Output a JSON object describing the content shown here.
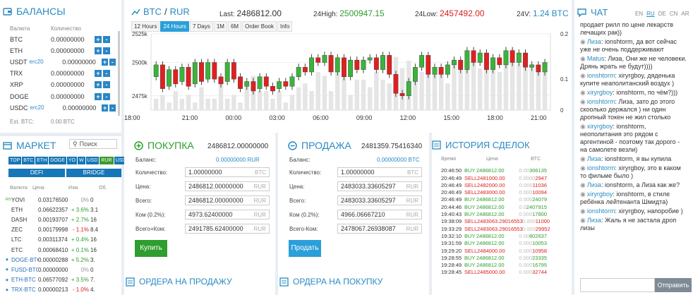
{
  "balances": {
    "title": "БАЛАНСЫ",
    "col_currency": "Валюта",
    "col_amount": "Количество",
    "rows": [
      {
        "c": "BTC",
        "tag": "",
        "v": "0.00000000"
      },
      {
        "c": "ETH",
        "tag": "",
        "v": "0.00000000"
      },
      {
        "c": "USDT",
        "tag": "erc20",
        "v": "0.00000000"
      },
      {
        "c": "TRX",
        "tag": "",
        "v": "0.00000000"
      },
      {
        "c": "XRP",
        "tag": "",
        "v": "0.00000000"
      },
      {
        "c": "DOGE",
        "tag": "",
        "v": "0.00000000"
      },
      {
        "c": "USDC",
        "tag": "erc20",
        "v": "0.00000000"
      }
    ],
    "est_label": "Est. BTC:",
    "est_value": "0.00 BTC",
    "plus": "+",
    "minus": "-"
  },
  "market": {
    "title": "МАРКЕТ",
    "search_placeholder": "Поиск",
    "tabs": [
      "TOP",
      "BTC",
      "ETH",
      "DOGE",
      "YO",
      "W",
      "USD",
      "RUR",
      "USDT"
    ],
    "subtabs": [
      "DEFI",
      "BRIDGE"
    ],
    "cols": [
      "Валюта",
      "Цена",
      "Изм.",
      "Об."
    ],
    "rows": [
      {
        "c": "YOVI",
        "p": "0.03176500",
        "ch": "0%",
        "o": "0",
        "cls": "gray",
        "icon": "ROM"
      },
      {
        "c": "ETH",
        "p": "0.06622357",
        "ch": "+ 3.6%",
        "o": "3.1",
        "cls": "green",
        "icon": ""
      },
      {
        "c": "DASH",
        "p": "0.00193707",
        "ch": "+ 2.7%",
        "o": "16",
        "cls": "green",
        "icon": ""
      },
      {
        "c": "ZEC",
        "p": "0.00179998",
        "ch": "- 1.1%",
        "o": "8.4",
        "cls": "red",
        "icon": ""
      },
      {
        "c": "LTC",
        "p": "0.00311374",
        "ch": "+ 0.4%",
        "o": "16",
        "cls": "green",
        "icon": ""
      },
      {
        "c": "ETC",
        "p": "0.00068410",
        "ch": "+ 0.1%",
        "o": "16",
        "cls": "green",
        "icon": ""
      },
      {
        "c": "DOGE-BTC",
        "p": "0.00000288",
        "ch": "+ 5.2%",
        "o": "3.",
        "cls": "green",
        "icon": "◆"
      },
      {
        "c": "FUSD-BTC",
        "p": "0.00000000",
        "ch": "0%",
        "o": "0",
        "cls": "gray",
        "icon": "◆"
      },
      {
        "c": "ETH-BTC",
        "p": "0.06577092",
        "ch": "+ 3.5%",
        "o": "7.",
        "cls": "green",
        "icon": "◆"
      },
      {
        "c": "TRX-BTC",
        "p": "0.00000213",
        "ch": "- 1.0%",
        "o": "4.",
        "cls": "red",
        "icon": "◆"
      }
    ]
  },
  "ticker": {
    "base": "BTC",
    "sep": "/",
    "quote": "RUR",
    "last_label": "Last:",
    "last": "2486812.00",
    "high_label": "24High:",
    "high": "2500947.15",
    "low_label": "24Low:",
    "low": "2457492.00",
    "vol_label": "24V:",
    "vol": "1.24 BTC"
  },
  "chart_tabs": [
    "12 Hours",
    "24 Hours",
    "7 Days",
    "1M",
    "6M",
    "Order Book",
    "Info"
  ],
  "chart_data": {
    "type": "candlestick",
    "y_ticks": [
      "2525k",
      "2500k",
      "2475k"
    ],
    "y2_ticks": [
      "0.2",
      "0.1",
      "0"
    ],
    "x": [
      "18:00",
      "21:00",
      "00:00",
      "03:00",
      "06:00",
      "09:00",
      "12:00",
      "15:00",
      "18:00",
      "21:00"
    ],
    "candles": [
      [
        2482,
        2487
      ],
      [
        2487,
        2477
      ],
      [
        2478,
        2485
      ],
      [
        2485,
        2479
      ],
      [
        2480,
        2486
      ],
      [
        2486,
        2478
      ],
      [
        2479,
        2488
      ],
      [
        2488,
        2480
      ],
      [
        2481,
        2488
      ],
      [
        2488,
        2481
      ],
      [
        2482,
        2479
      ],
      [
        2480,
        2488
      ],
      [
        2488,
        2481
      ],
      [
        2482,
        2477
      ],
      [
        2478,
        2480
      ],
      [
        2480,
        2476
      ],
      [
        2477,
        2482
      ],
      [
        2482,
        2478
      ],
      [
        2478,
        2476
      ],
      [
        2477,
        2480
      ],
      [
        2480,
        2478
      ],
      [
        2478,
        2482
      ],
      [
        2482,
        2486
      ],
      [
        2486,
        2484
      ],
      [
        2484,
        2490
      ],
      [
        2490,
        2488
      ],
      [
        2488,
        2491
      ],
      [
        2491,
        2484
      ],
      [
        2484,
        2490
      ],
      [
        2490,
        2482
      ],
      [
        2482,
        2489
      ],
      [
        2489,
        2485
      ],
      [
        2485,
        2489
      ],
      [
        2489,
        2490
      ],
      [
        2490,
        2485
      ],
      [
        2485,
        2491
      ],
      [
        2491,
        2483
      ],
      [
        2483,
        2475
      ],
      [
        2475,
        2474
      ],
      [
        2474,
        2480
      ],
      [
        2480,
        2486
      ],
      [
        2486,
        2491
      ],
      [
        2491,
        2483
      ],
      [
        2483,
        2486
      ],
      [
        2486,
        2483
      ],
      [
        2483,
        2487
      ],
      [
        2487,
        2489
      ],
      [
        2489,
        2485
      ],
      [
        2485,
        2493
      ],
      [
        2493,
        2488
      ],
      [
        2488,
        2492
      ],
      [
        2492,
        2485
      ],
      [
        2485,
        2490
      ],
      [
        2490,
        2487
      ],
      [
        2487,
        2493
      ],
      [
        2493,
        2488
      ],
      [
        2488,
        2492
      ],
      [
        2492,
        2486
      ],
      [
        2486,
        2487
      ],
      [
        2487,
        2484
      ],
      [
        2484,
        2488
      ]
    ],
    "volumes": [
      0.03,
      0.04,
      0.02,
      0.05,
      0.03,
      0.04,
      0.02,
      0.06,
      0.03,
      0.03,
      0.08,
      0.03,
      0.04,
      0.02,
      0.07,
      0.09,
      0.05,
      0.05,
      0.03,
      0.05,
      0.02,
      0.04,
      0.06,
      0.07,
      0.05,
      0.1,
      0.09,
      0.05,
      0.12,
      0.1,
      0.04,
      0.08,
      0.08,
      0.06,
      0.1,
      0.08,
      0.07,
      0.14,
      0.11,
      0.13,
      0.09,
      0.1,
      0.12,
      0.11,
      0.1,
      0.07,
      0.12,
      0.12,
      0.13,
      0.15,
      0.11,
      0.14,
      0.12,
      0.1,
      0.13,
      0.16,
      0.12,
      0.14,
      0.12,
      0.1,
      0.11
    ]
  },
  "buy": {
    "title": "ПОКУПКА",
    "price": "2486812.00000000",
    "balance_label": "Баланс:",
    "balance": "0.00000000 RUR",
    "qty_label": "Количество:",
    "qty": "1.00000000",
    "qty_unit": "BTC",
    "price_label": "Цена:",
    "price_val": "2486812.00000000",
    "price_unit": "RUR",
    "total_label": "Всего:",
    "total": "2486812.00000000",
    "total_unit": "RUR",
    "fee_label": "Ком (0.2%):",
    "fee": "4973.62400000",
    "fee_unit": "RUR",
    "totalfee_label": "Всего+Ком:",
    "totalfee": "2491785.62400000",
    "totalfee_unit": "RUR",
    "button": "Купить",
    "orders_title": "ОРДЕРА НА ПРОДАЖУ"
  },
  "sell": {
    "title": "ПРОДАЖА",
    "price": "2481359.75416340",
    "balance_label": "Баланс:",
    "balance": "0.00000000 BTC",
    "qty_label": "Количество:",
    "qty": "1.00000000",
    "qty_unit": "BTC",
    "price_label": "Цена:",
    "price_val": "2483033.33605297",
    "price_unit": "RUR",
    "total_label": "Всего:",
    "total": "2483033.33605297",
    "total_unit": "RUR",
    "fee_label": "Ком (0.2%):",
    "fee": "4966.06667210",
    "fee_unit": "RUR",
    "totalfee_label": "Всего-Ком:",
    "totalfee": "2478067.26938087",
    "totalfee_unit": "RUR",
    "button": "Продать",
    "orders_title": "ОРДЕРА НА ПОКУПКУ"
  },
  "history": {
    "title": "ИСТОРИЯ СДЕЛОК",
    "cols": [
      "Время",
      "",
      "Цена",
      "BTC"
    ],
    "rows": [
      {
        "t": "20:46:50",
        "s": "BUY",
        "p": "2486812.00",
        "a": "0.00306135"
      },
      {
        "t": "20:46:49",
        "s": "SELL",
        "p": "2481000.00",
        "a": "0.00002947"
      },
      {
        "t": "20:46:49",
        "s": "SELL",
        "p": "2482000.00",
        "a": "0.00011036"
      },
      {
        "t": "20:46:49",
        "s": "SELL",
        "p": "2483000.00",
        "a": "0.00010094"
      },
      {
        "t": "20:46:49",
        "s": "BUY",
        "p": "2486812.00",
        "a": "0.00024079"
      },
      {
        "t": "20:44:46",
        "s": "BUY",
        "p": "2486812.00",
        "a": "0.02407915"
      },
      {
        "t": "19:40:43",
        "s": "BUY",
        "p": "2486812.00",
        "a": "0.00017800"
      },
      {
        "t": "19:38:09",
        "s": "SELL",
        "p": "2483063.29016553",
        "a": "0.00011000"
      },
      {
        "t": "19:33:29",
        "s": "SELL",
        "p": "2483063.29016553",
        "a": "0.00029952"
      },
      {
        "t": "19:32:10",
        "s": "BUY",
        "p": "2486812.00",
        "a": "0.00802637"
      },
      {
        "t": "19:31:59",
        "s": "BUY",
        "p": "2486812.00",
        "a": "0.00010053"
      },
      {
        "t": "19:29:20",
        "s": "SELL",
        "p": "2484000.00",
        "a": "0.00010958"
      },
      {
        "t": "19:28:55",
        "s": "BUY",
        "p": "2486812.00",
        "a": "0.00023335"
      },
      {
        "t": "19:28:49",
        "s": "BUY",
        "p": "2486812.00",
        "a": "0.00016795"
      },
      {
        "t": "19:28:45",
        "s": "SELL",
        "p": "2485000.00",
        "a": "0.00032744"
      }
    ]
  },
  "chat": {
    "title": "ЧАТ",
    "langs": [
      "EN",
      "RU",
      "DE",
      "CN",
      "AR"
    ],
    "send": "Отправить",
    "msgs": [
      {
        "n": "",
        "t": "продает рилл по цене лекарств лечащих рак))"
      },
      {
        "n": "Лиза",
        "t": ": ionshtorm, да вот сейчас уже не очень поддерживают"
      },
      {
        "n": "Matus",
        "t": ": Лиза, Они же не человеки. Дрянь жрать не будут))))"
      },
      {
        "n": "ionshtorm",
        "t": ": xiryrgboy, дяденька купите неаполитанский воздух )"
      },
      {
        "n": "xiryrgboy",
        "t": ": ionshtorm, по чём?)))"
      },
      {
        "n": "ionshtorm",
        "t": ": Лиза, зато до этого скоолько держался ) ни один дропный токен не жил столько"
      },
      {
        "n": "xiryrgboy",
        "t": ": ionshtorm, неополитания это рядом с аргентиной - поэтому так дорого - на самолете везли)"
      },
      {
        "n": "Лиза",
        "t": ": ionshtorm, я вы купила"
      },
      {
        "n": "ionshtorm",
        "t": ": xiryrgboy, это в каком то фильме было )"
      },
      {
        "n": "Лиза",
        "t": ": ionshtorm, а Лиза как же?"
      },
      {
        "n": "xiryrgboy",
        "t": ": ionshtorm, в стиле ребёнка лейтенанта Шмидта)"
      },
      {
        "n": "ionshtorm",
        "t": ": xiryrgboy, напоробие )"
      },
      {
        "n": "Лиза",
        "t": ": Жаль я не застала дроп лизы"
      }
    ]
  }
}
